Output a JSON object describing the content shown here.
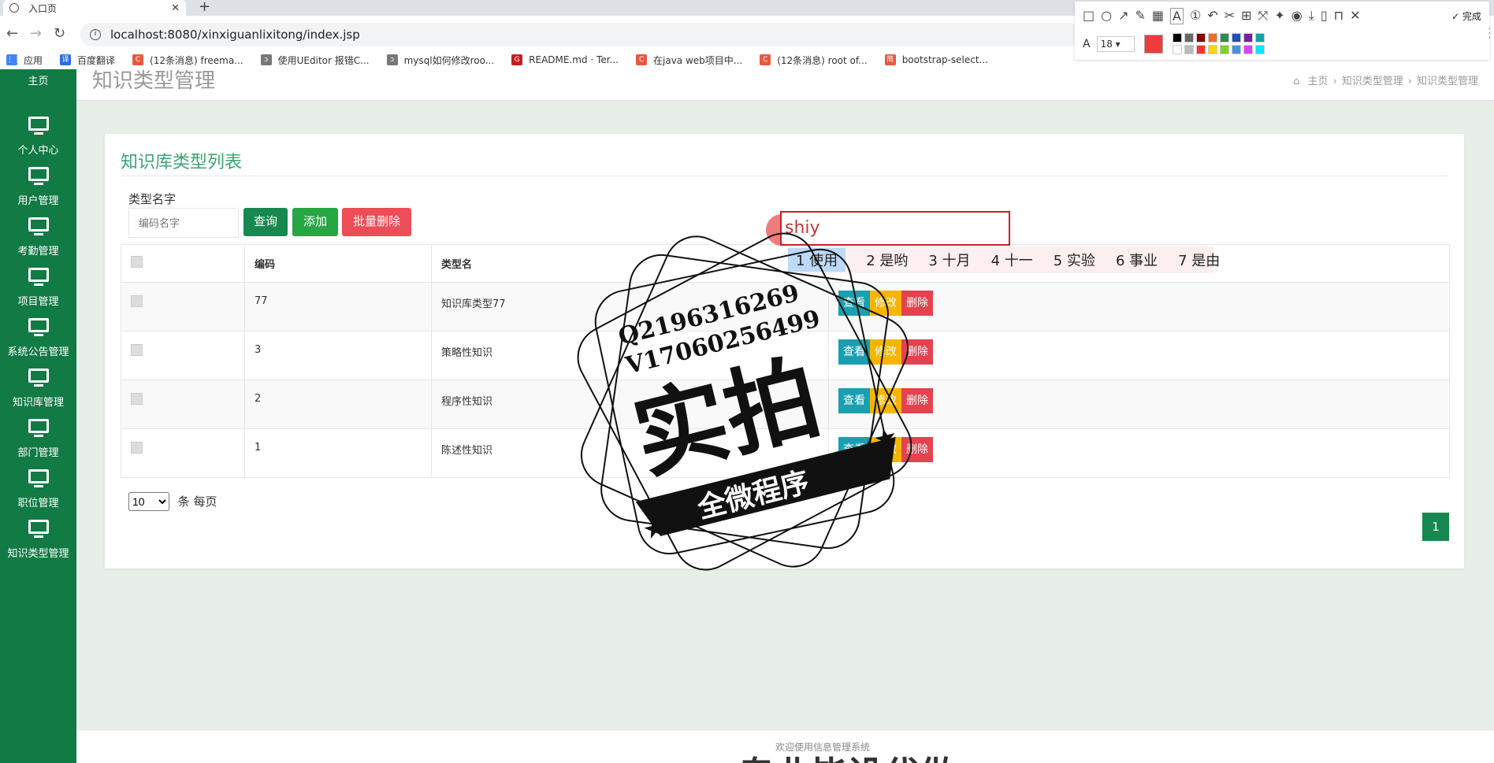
{
  "browser": {
    "tab_title": "入口页",
    "url": "localhost:8080/xinxiguanlixitong/index.jsp",
    "bookmarks": [
      {
        "label": "应用",
        "color": "#4285f4",
        "glyph": "⋮⋮"
      },
      {
        "label": "百度翻译",
        "color": "#2b6de8",
        "glyph": "译"
      },
      {
        "label": "(12条消息) freema...",
        "color": "#e9573f",
        "glyph": "C"
      },
      {
        "label": "使用UEditor 报错C...",
        "color": "#777777",
        "glyph": "ↄ"
      },
      {
        "label": "mysql如何修改roo...",
        "color": "#777777",
        "glyph": "ↄ"
      },
      {
        "label": "README.md · Ter...",
        "color": "#c71d23",
        "glyph": "G"
      },
      {
        "label": "在java web项目中...",
        "color": "#e9573f",
        "glyph": "C"
      },
      {
        "label": "(12条消息) root of...",
        "color": "#e9573f",
        "glyph": "C"
      },
      {
        "label": "bootstrap-select...",
        "color": "#e9573f",
        "glyph": "简"
      }
    ]
  },
  "sidebar": {
    "items": [
      {
        "label": "主页"
      },
      {
        "label": "个人中心"
      },
      {
        "label": "用户管理"
      },
      {
        "label": "考勤管理"
      },
      {
        "label": "项目管理"
      },
      {
        "label": "系统公告管理"
      },
      {
        "label": "知识库管理"
      },
      {
        "label": "部门管理"
      },
      {
        "label": "职位管理"
      },
      {
        "label": "知识类型管理"
      }
    ]
  },
  "header": {
    "page_heading": "知识类型管理",
    "breadcrumb": [
      "主页",
      "›",
      "知识类型管理",
      "›",
      "知识类型管理"
    ]
  },
  "panel": {
    "title": "知识库类型列表",
    "search_label": "类型名字",
    "search_placeholder": "编码名字",
    "query_label": "查询",
    "add_label": "添加",
    "batch_delete_label": "批量删除",
    "columns": [
      "编码",
      "类型名"
    ],
    "rows": [
      {
        "code": "77",
        "name": "知识库类型77"
      },
      {
        "code": "3",
        "name": "策略性知识"
      },
      {
        "code": "2",
        "name": "程序性知识"
      },
      {
        "code": "1",
        "name": "陈述性知识"
      }
    ],
    "actions": {
      "view": "查看",
      "edit": "修改",
      "delete": "删除"
    },
    "page_size": "10",
    "page_size_suffix": "条 每页",
    "current_page": "1"
  },
  "footer": {
    "text": "欢迎使用信息管理系统",
    "big_text": "专业毕设代做"
  },
  "ime": {
    "input": "shiy",
    "candidates": [
      "1 使用",
      "2 是哟",
      "3 十月",
      "4 十一",
      "5 实验",
      "6 事业",
      "7 是由"
    ]
  },
  "annotation_toolbar": {
    "font_size": "18",
    "done_label": "完成",
    "current_color": "#ef3b3b",
    "swatches": [
      "#000000",
      "#666666",
      "#8b0000",
      "#ef6c2b",
      "#2e8b57",
      "#1e4fbf",
      "#7b1fa2",
      "#0aa6a6",
      "#ffffff",
      "#bbbbbb",
      "#ff3333",
      "#ffd600",
      "#7ed321",
      "#4a90e2",
      "#e040fb",
      "#00e5ff"
    ]
  },
  "watermark": {
    "line1": "Q2196316269",
    "line2": "V17060256499",
    "main": "实拍",
    "ribbon": "全微程序"
  }
}
